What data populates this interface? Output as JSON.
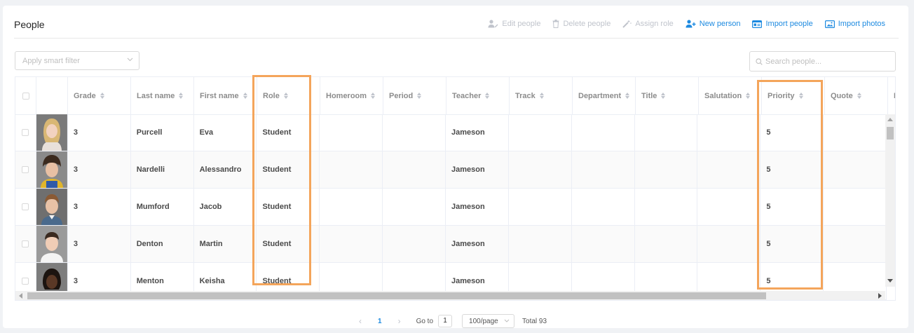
{
  "page": {
    "title": "People"
  },
  "toolbar": {
    "edit": "Edit people",
    "delete": "Delete people",
    "assign": "Assign role",
    "new": "New person",
    "import_people": "Import people",
    "import_photos": "Import photos",
    "disabled_color": "#c0c4cc",
    "enabled_color": "#1d8ae0"
  },
  "filter": {
    "placeholder": "Apply smart filter"
  },
  "search": {
    "placeholder": "Search people..."
  },
  "table": {
    "columns": [
      "Grade",
      "Last name",
      "First name",
      "Role",
      "Homeroom",
      "Period",
      "Teacher",
      "Track",
      "Department",
      "Title",
      "Salutation",
      "Priority",
      "Quote",
      "N"
    ],
    "rows": [
      {
        "grade": "3",
        "last": "Purcell",
        "first": "Eva",
        "role": "Student",
        "homeroom": "",
        "period": "",
        "teacher": "Jameson",
        "track": "",
        "department": "",
        "title": "",
        "salutation": "",
        "priority": "5",
        "quote": ""
      },
      {
        "grade": "3",
        "last": "Nardelli",
        "first": "Alessandro",
        "role": "Student",
        "homeroom": "",
        "period": "",
        "teacher": "Jameson",
        "track": "",
        "department": "",
        "title": "",
        "salutation": "",
        "priority": "5",
        "quote": ""
      },
      {
        "grade": "3",
        "last": "Mumford",
        "first": "Jacob",
        "role": "Student",
        "homeroom": "",
        "period": "",
        "teacher": "Jameson",
        "track": "",
        "department": "",
        "title": "",
        "salutation": "",
        "priority": "5",
        "quote": ""
      },
      {
        "grade": "3",
        "last": "Denton",
        "first": "Martin",
        "role": "Student",
        "homeroom": "",
        "period": "",
        "teacher": "Jameson",
        "track": "",
        "department": "",
        "title": "",
        "salutation": "",
        "priority": "5",
        "quote": ""
      },
      {
        "grade": "3",
        "last": "Menton",
        "first": "Keisha",
        "role": "Student",
        "homeroom": "",
        "period": "",
        "teacher": "Jameson",
        "track": "",
        "department": "",
        "title": "",
        "salutation": "",
        "priority": "5",
        "quote": ""
      }
    ],
    "highlight_color": "#f4a55b"
  },
  "pagination": {
    "current": "1",
    "goto_label": "Go to",
    "goto_value": "1",
    "page_size": "100/page",
    "total": "Total 93"
  }
}
